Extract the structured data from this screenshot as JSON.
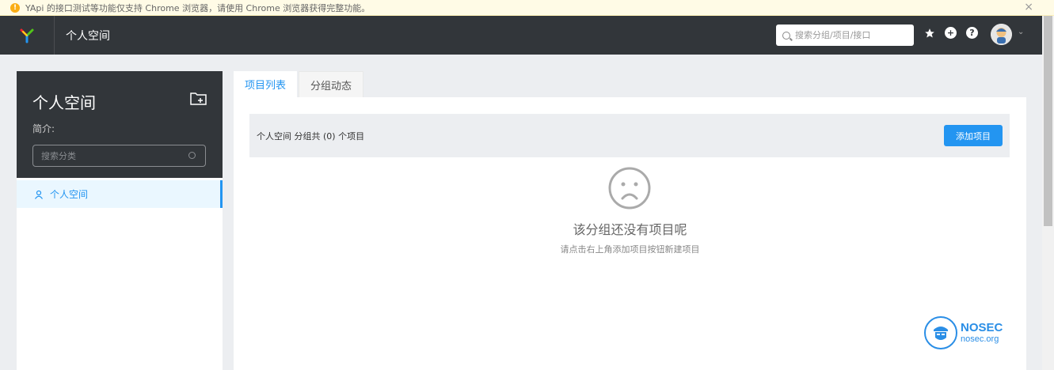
{
  "banner": {
    "message": "YApi 的接口测试等功能仅支持 Chrome 浏览器，请使用 Chrome 浏览器获得完整功能。",
    "close": "×"
  },
  "nav": {
    "title": "个人空间",
    "search_placeholder": "搜索分组/项目/接口",
    "caret": "⌄"
  },
  "sidebar": {
    "title": "个人空间",
    "intro_label": "简介:",
    "search_placeholder": "搜索分类",
    "items": [
      {
        "label": "个人空间"
      }
    ]
  },
  "tabs": [
    {
      "label": "项目列表"
    },
    {
      "label": "分组动态"
    }
  ],
  "main": {
    "info_text": "个人空间 分组共 (0) 个项目",
    "add_button": "添加项目",
    "empty_title": "该分组还没有项目呢",
    "empty_subtitle": "请点击右上角添加项目按钮新建项目"
  },
  "watermark": {
    "brand": "NOSEC",
    "domain": "nosec.org"
  },
  "colors": {
    "nav_bg": "#32363a",
    "accent": "#2395f1",
    "banner_bg": "#fffbe6",
    "warn": "#faad14"
  }
}
